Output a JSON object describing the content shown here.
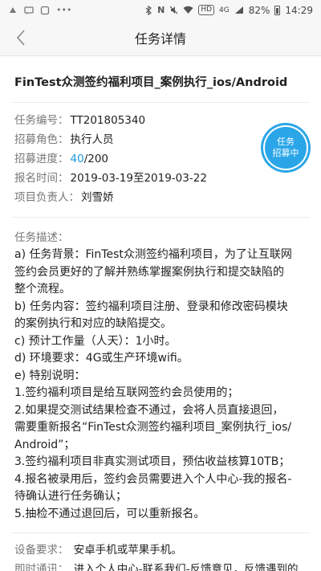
{
  "status_bar": {
    "battery": "82%",
    "time": "14:29",
    "network": "4G",
    "hd": "HD"
  },
  "nav": {
    "title": "任务详情",
    "back_icon": "chevron-left-icon"
  },
  "task": {
    "title": "FinTest众测签约福利项目_案例执行_ios/Android",
    "number_label": "任务编号：",
    "number": "TT201805340",
    "role_label": "招募角色：",
    "role": "执行人员",
    "progress_label": "招募进度：",
    "progress_current": "40",
    "progress_total": "/200",
    "time_label": "报名时间：",
    "time": "2019-03-19至2019-03-22",
    "owner_label": "项目负责人：",
    "owner": "刘雪娇",
    "stamp_line1": "任务",
    "stamp_line2": "招募中"
  },
  "description": {
    "label": "任务描述：",
    "lines": [
      "a) 任务背景：FinTest众测签约福利项目，为了让互联网",
      "签约会员更好的了解并熟练掌握案例执行和提交缺陷的",
      "整个流程。",
      "b) 任务内容：签约福利项目注册、登录和修改密码模块",
      "的案例执行和对应的缺陷提交。",
      "c) 预计工作量（人天）：1小时。",
      "d) 环境要求：4G或生产环境wifi。",
      "e) 特别说明：",
      "1.签约福利项目是给互联网签约会员使用的；",
      "2.如果提交测试结果检查不通过，会将人员直接退回，",
      "需要重新报名“FinTest众测签约福利项目_案例执行_ios/",
      "Android”；",
      "3.签约福利项目非真实测试项目，预估收益核算10TB；",
      "4.报名被录用后，签约会员需要进入个人中心-我的报名-",
      "待确认进行任务确认；",
      "5.抽检不通过退回后，可以重新报名。"
    ]
  },
  "requirements": {
    "device_label": "设备要求：",
    "device": "安卓手机或苹果手机。",
    "notify_label": "即时通讯：",
    "notify": "进入个人中心-联系我们-反馈意见，反馈遇到的"
  },
  "colors": {
    "accent": "#1a9be0",
    "stamp": "#2aa6e8"
  }
}
